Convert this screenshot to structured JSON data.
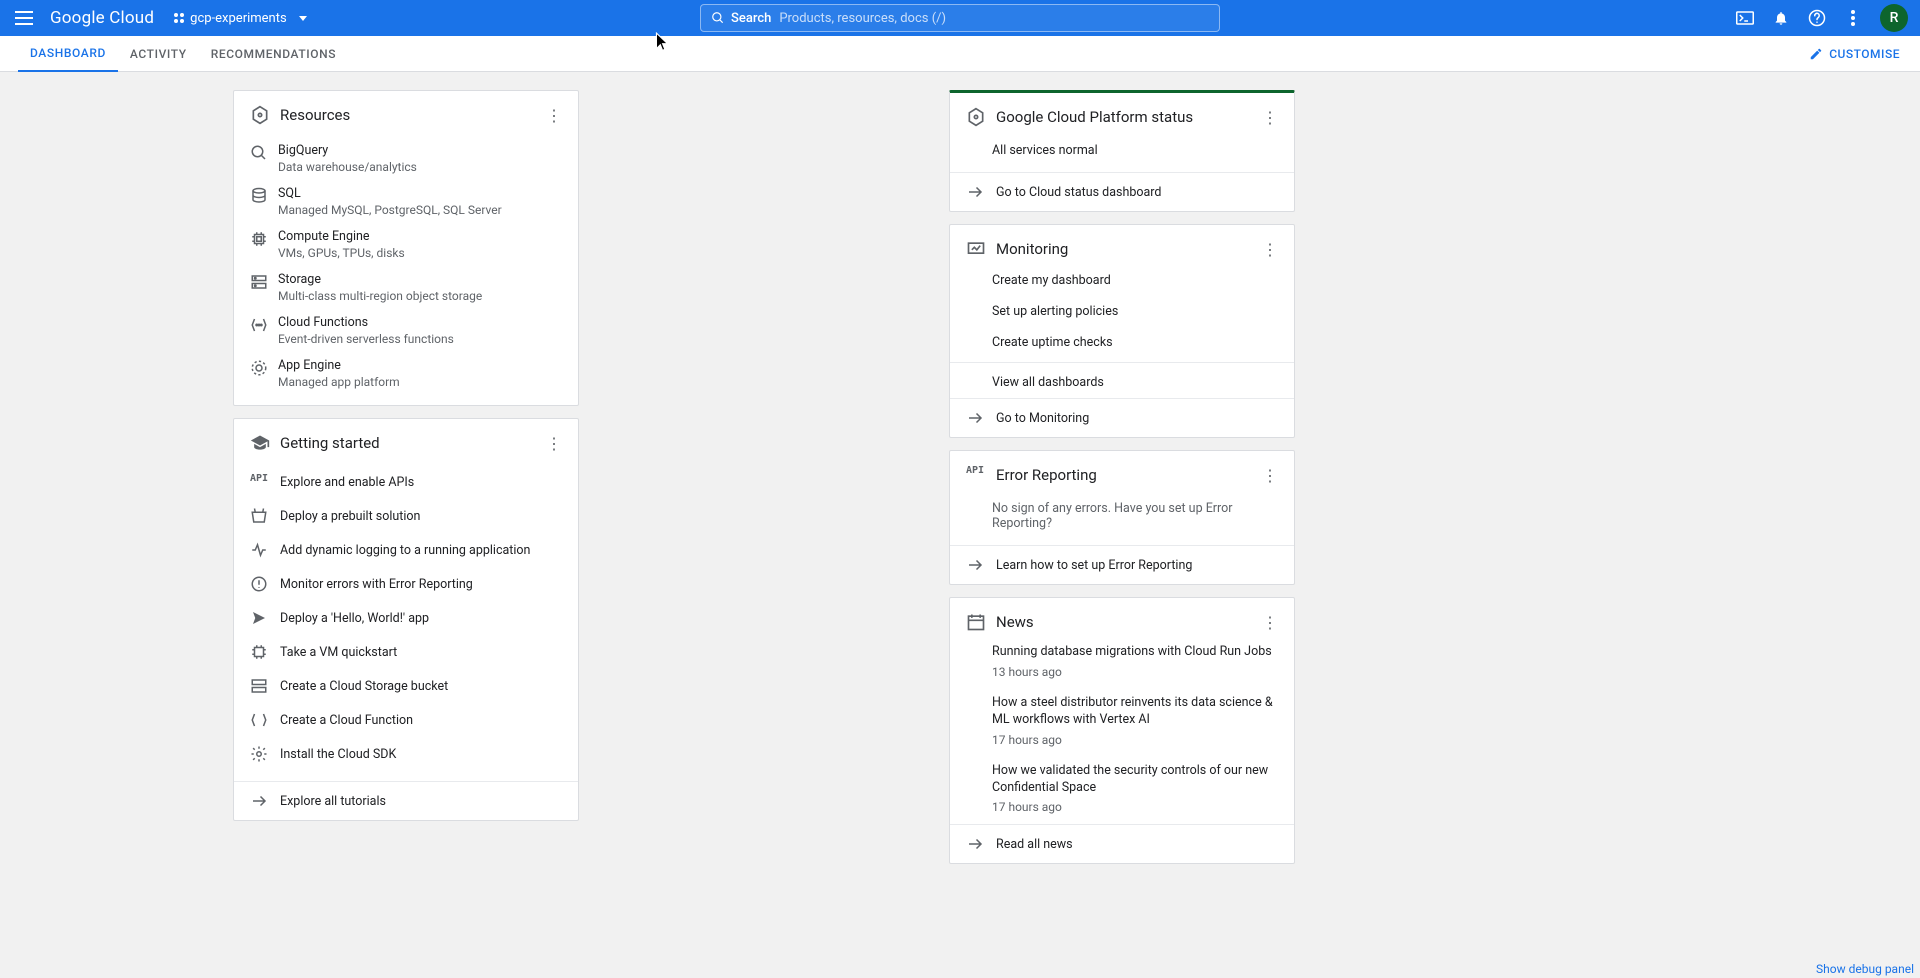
{
  "header": {
    "logo_left": "Google",
    "logo_right": "Cloud",
    "project": "gcp-experiments",
    "search_label": "Search",
    "search_placeholder": "Products, resources, docs (/)",
    "avatar_initial": "R"
  },
  "tabs": {
    "dashboard": "DASHBOARD",
    "activity": "ACTIVITY",
    "recommendations": "RECOMMENDATIONS",
    "customise": "CUSTOMISE"
  },
  "resources": {
    "title": "Resources",
    "items": [
      {
        "name": "BigQuery",
        "desc": "Data warehouse/analytics"
      },
      {
        "name": "SQL",
        "desc": "Managed MySQL, PostgreSQL, SQL Server"
      },
      {
        "name": "Compute Engine",
        "desc": "VMs, GPUs, TPUs, disks"
      },
      {
        "name": "Storage",
        "desc": "Multi-class multi-region object storage"
      },
      {
        "name": "Cloud Functions",
        "desc": "Event-driven serverless functions"
      },
      {
        "name": "App Engine",
        "desc": "Managed app platform"
      }
    ]
  },
  "getting_started": {
    "title": "Getting started",
    "items": [
      "Explore and enable APIs",
      "Deploy a prebuilt solution",
      "Add dynamic logging to a running application",
      "Monitor errors with Error Reporting",
      "Deploy a 'Hello, World!' app",
      "Take a VM quickstart",
      "Create a Cloud Storage bucket",
      "Create a Cloud Function",
      "Install the Cloud SDK"
    ],
    "footer": "Explore all tutorials"
  },
  "gcp_status": {
    "title": "Google Cloud Platform status",
    "body": "All services normal",
    "footer": "Go to Cloud status dashboard"
  },
  "monitoring": {
    "title": "Monitoring",
    "links": [
      "Create my dashboard",
      "Set up alerting policies",
      "Create uptime checks"
    ],
    "view_all": "View all dashboards",
    "footer": "Go to Monitoring"
  },
  "error_reporting": {
    "title": "Error Reporting",
    "body": "No sign of any errors. Have you set up Error Reporting?",
    "footer": "Learn how to set up Error Reporting"
  },
  "news": {
    "title": "News",
    "items": [
      {
        "title": "Running database migrations with Cloud Run Jobs",
        "time": "13 hours ago"
      },
      {
        "title": "How a steel distributor reinvents its data science & ML workflows with Vertex AI",
        "time": "17 hours ago"
      },
      {
        "title": "How we validated the security controls of our new Confidential Space",
        "time": "17 hours ago"
      }
    ],
    "footer": "Read all news"
  },
  "debug": "Show debug panel"
}
